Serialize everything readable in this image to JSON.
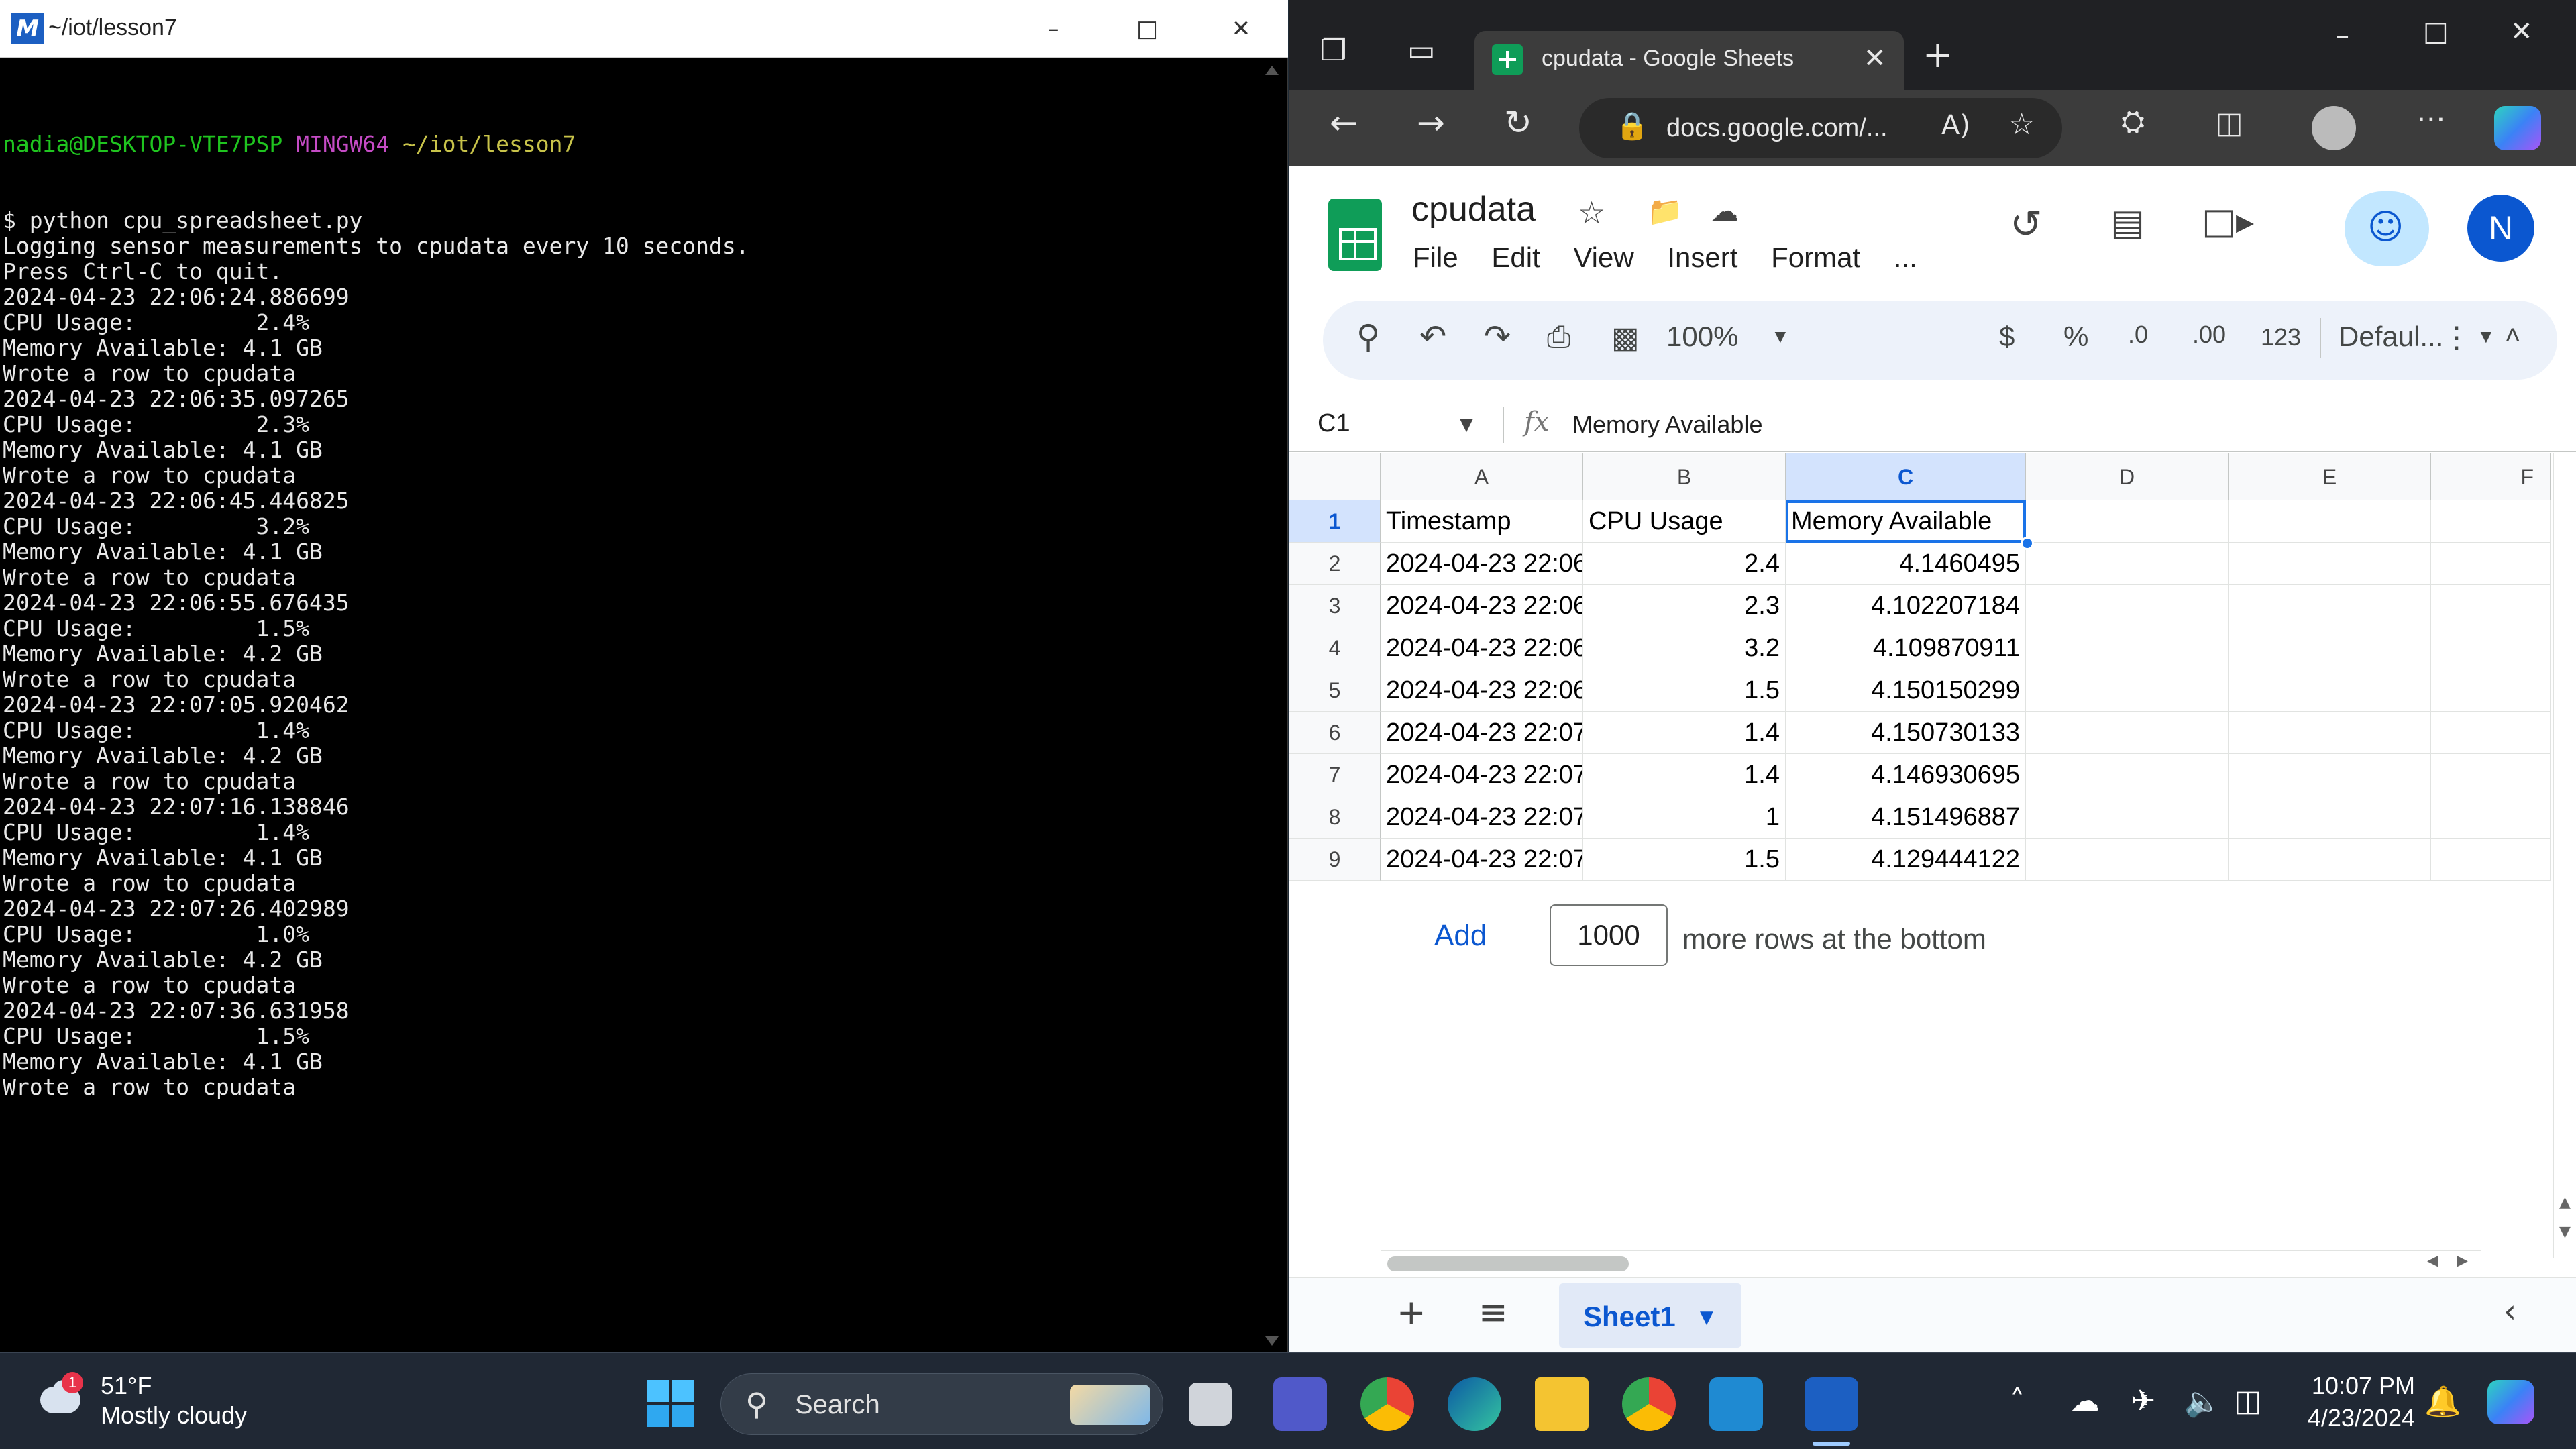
{
  "terminal": {
    "title": "~/iot/lesson7",
    "prompt_user": "nadia@DESKTOP-VTE7PSP",
    "prompt_system": "MINGW64",
    "prompt_path": "~/iot/lesson7",
    "lines": [
      "$ python cpu_spreadsheet.py",
      "Logging sensor measurements to cpudata every 10 seconds.",
      "Press Ctrl-C to quit.",
      "2024-04-23 22:06:24.886699",
      "CPU Usage:         2.4%",
      "Memory Available: 4.1 GB",
      "Wrote a row to cpudata",
      "2024-04-23 22:06:35.097265",
      "CPU Usage:         2.3%",
      "Memory Available: 4.1 GB",
      "Wrote a row to cpudata",
      "2024-04-23 22:06:45.446825",
      "CPU Usage:         3.2%",
      "Memory Available: 4.1 GB",
      "Wrote a row to cpudata",
      "2024-04-23 22:06:55.676435",
      "CPU Usage:         1.5%",
      "Memory Available: 4.2 GB",
      "Wrote a row to cpudata",
      "2024-04-23 22:07:05.920462",
      "CPU Usage:         1.4%",
      "Memory Available: 4.2 GB",
      "Wrote a row to cpudata",
      "2024-04-23 22:07:16.138846",
      "CPU Usage:         1.4%",
      "Memory Available: 4.1 GB",
      "Wrote a row to cpudata",
      "2024-04-23 22:07:26.402989",
      "CPU Usage:         1.0%",
      "Memory Available: 4.2 GB",
      "Wrote a row to cpudata",
      "2024-04-23 22:07:36.631958",
      "CPU Usage:         1.5%",
      "Memory Available: 4.1 GB",
      "Wrote a row to cpudata"
    ]
  },
  "browser": {
    "tab_title": "cpudata - Google Sheets",
    "url": "docs.google.com/...",
    "doc_title": "cpudata",
    "menu": [
      "File",
      "Edit",
      "View",
      "Insert",
      "Format",
      "..."
    ],
    "avatar_letter": "N",
    "toolbar": {
      "zoom": "100%",
      "currency": "$",
      "percent": "%",
      "decrease_decimal": ".0",
      "increase_decimal": ".00",
      "number_format": "123",
      "font": "Defaul..."
    },
    "name_box": "C1",
    "formula": "Memory Available",
    "columns": [
      "A",
      "B",
      "C",
      "D",
      "E",
      "F"
    ],
    "rows": [
      {
        "n": "1",
        "a": "Timestamp",
        "b": "CPU Usage",
        "c": "Memory Available"
      },
      {
        "n": "2",
        "a": "2024-04-23 22:06",
        "b": "2.4",
        "c": "4.1460495"
      },
      {
        "n": "3",
        "a": "2024-04-23 22:06",
        "b": "2.3",
        "c": "4.102207184"
      },
      {
        "n": "4",
        "a": "2024-04-23 22:06",
        "b": "3.2",
        "c": "4.109870911"
      },
      {
        "n": "5",
        "a": "2024-04-23 22:06",
        "b": "1.5",
        "c": "4.150150299"
      },
      {
        "n": "6",
        "a": "2024-04-23 22:07",
        "b": "1.4",
        "c": "4.150730133"
      },
      {
        "n": "7",
        "a": "2024-04-23 22:07",
        "b": "1.4",
        "c": "4.146930695"
      },
      {
        "n": "8",
        "a": "2024-04-23 22:07",
        "b": "1",
        "c": "4.151496887"
      },
      {
        "n": "9",
        "a": "2024-04-23 22:07",
        "b": "1.5",
        "c": "4.129444122"
      }
    ],
    "add_rows": {
      "link": "Add",
      "count": "1000",
      "suffix": "more rows at the bottom"
    },
    "sheet_tab": "Sheet1"
  },
  "taskbar": {
    "weather_temp": "51°F",
    "weather_desc": "Mostly cloudy",
    "weather_badge": "1",
    "search_label": "Search",
    "time": "10:07 PM",
    "date": "4/23/2024"
  }
}
